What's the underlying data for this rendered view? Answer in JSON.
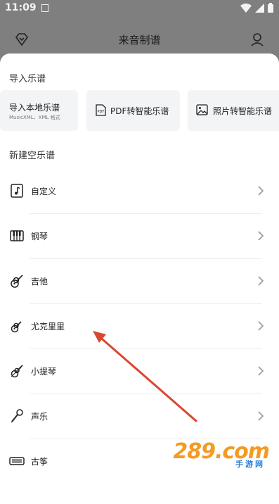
{
  "status_bar": {
    "time": "11:09"
  },
  "app_bar": {
    "title": "来音制谱"
  },
  "sheet": {
    "import_title": "导入乐谱",
    "import_cards": [
      {
        "label": "导入本地乐谱",
        "sub": "MusicXML、XML 格式"
      },
      {
        "label": "PDF转智能乐谱",
        "badge": "PDF"
      },
      {
        "label": "照片转智能乐谱"
      }
    ],
    "new_title": "新建空乐谱",
    "items": [
      {
        "label": "自定义",
        "icon": "music-note-icon"
      },
      {
        "label": "钢琴",
        "icon": "piano-icon"
      },
      {
        "label": "吉他",
        "icon": "guitar-icon"
      },
      {
        "label": "尤克里里",
        "icon": "ukulele-icon"
      },
      {
        "label": "小提琴",
        "icon": "violin-icon"
      },
      {
        "label": "声乐",
        "icon": "microphone-icon"
      },
      {
        "label": "古筝",
        "icon": "guzheng-icon"
      }
    ]
  },
  "watermark": {
    "brand": "289.com",
    "sub": "手游网"
  },
  "colors": {
    "arrow": "#d9472f",
    "overlay": "#7f7f7f",
    "watermark_orange": "#f59a22",
    "watermark_blue": "#2d7fd6"
  }
}
